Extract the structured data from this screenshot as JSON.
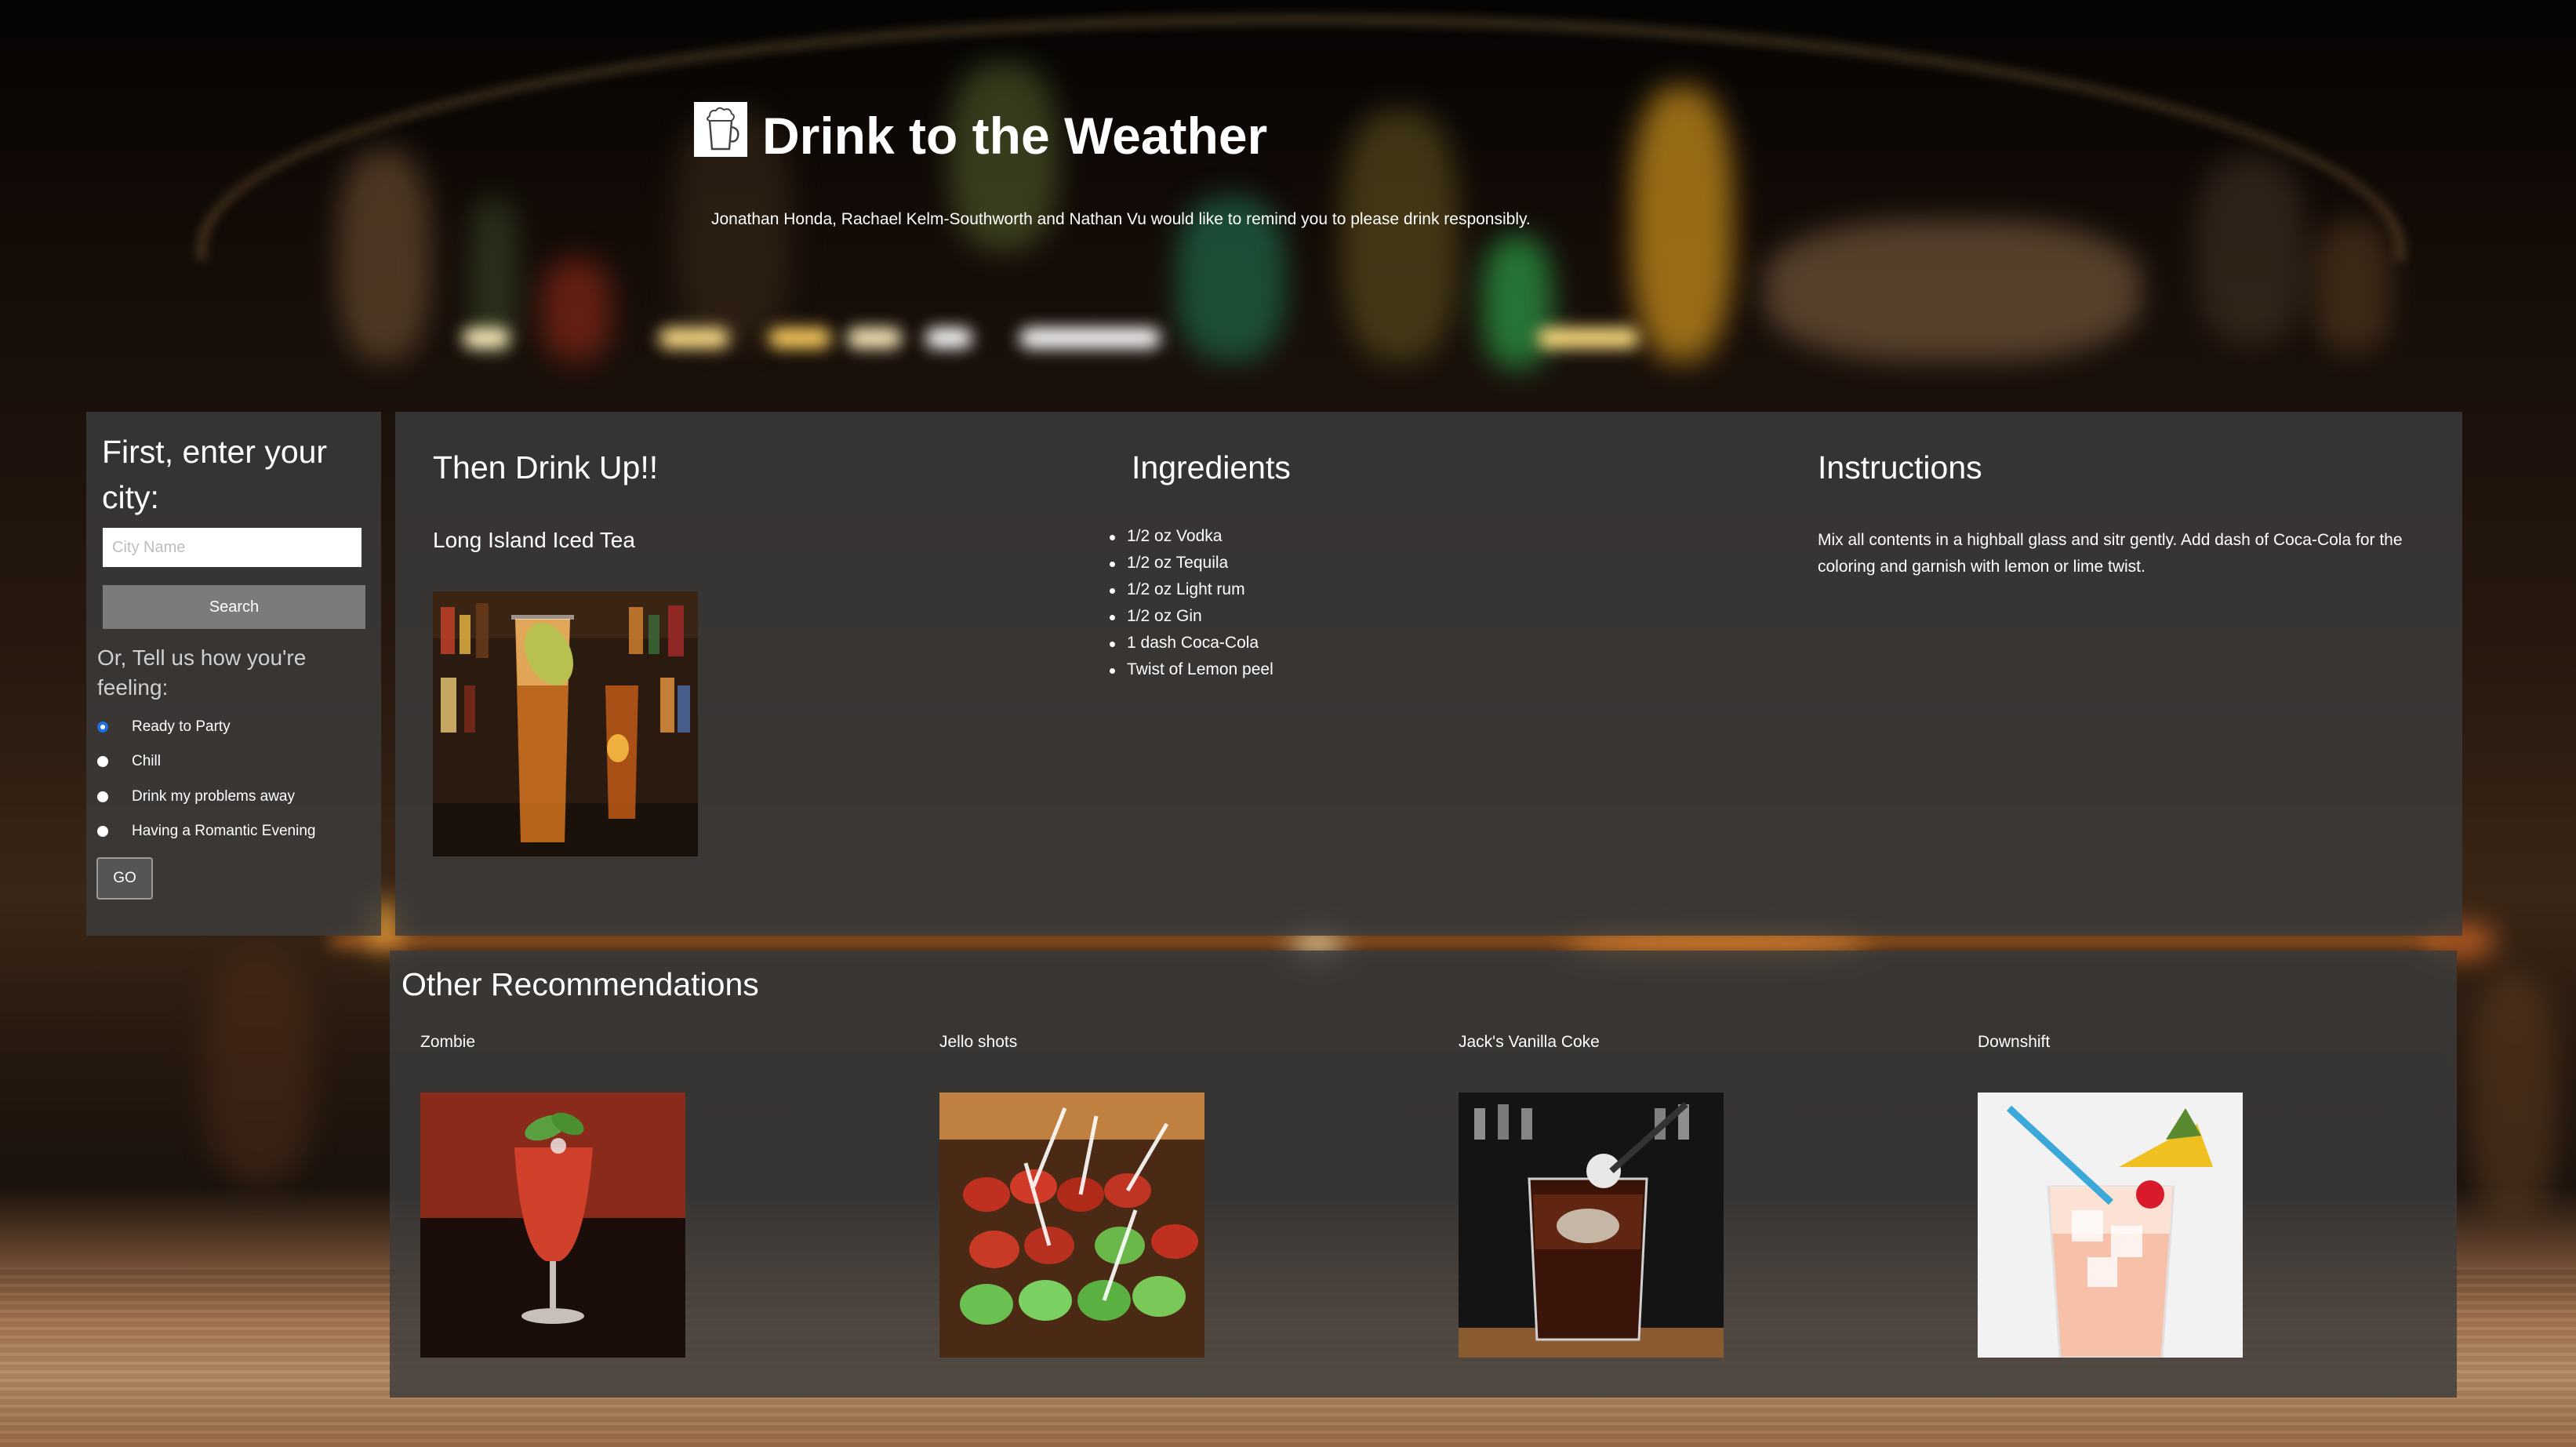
{
  "header": {
    "title": "Drink to the Weather",
    "subtitle": "Jonathan Honda, Rachael Kelm-Southworth and Nathan Vu would like to remind you to please drink responsibly.",
    "logo_icon": "cocktail-glass-icon"
  },
  "search": {
    "heading": "First, enter your city:",
    "placeholder": "City Name",
    "button_label": "Search"
  },
  "mood": {
    "heading": "Or, Tell us how you're feeling:",
    "options": [
      {
        "label": "Ready to Party",
        "checked": true
      },
      {
        "label": "Chill",
        "checked": false
      },
      {
        "label": "Drink my problems away",
        "checked": false
      },
      {
        "label": "Having a Romantic Evening",
        "checked": false
      }
    ],
    "go_label": "GO"
  },
  "main": {
    "drink_heading": "Then Drink Up!!",
    "drink_name": "Long Island Iced Tea",
    "ingredients_heading": "Ingredients",
    "ingredients": [
      "1/2 oz Vodka",
      "1/2 oz Tequila",
      "1/2 oz Light rum",
      "1/2 oz Gin",
      "1 dash Coca-Cola",
      "Twist of Lemon peel"
    ],
    "instructions_heading": "Instructions",
    "instructions": "Mix all contents in a highball glass and sitr gently. Add dash of Coca-Cola for the coloring and garnish with lemon or lime twist."
  },
  "recommendations": {
    "heading": "Other Recommendations",
    "items": [
      {
        "name": "Zombie"
      },
      {
        "name": "Jello shots"
      },
      {
        "name": "Jack's Vanilla Coke"
      },
      {
        "name": "Downshift"
      }
    ]
  }
}
